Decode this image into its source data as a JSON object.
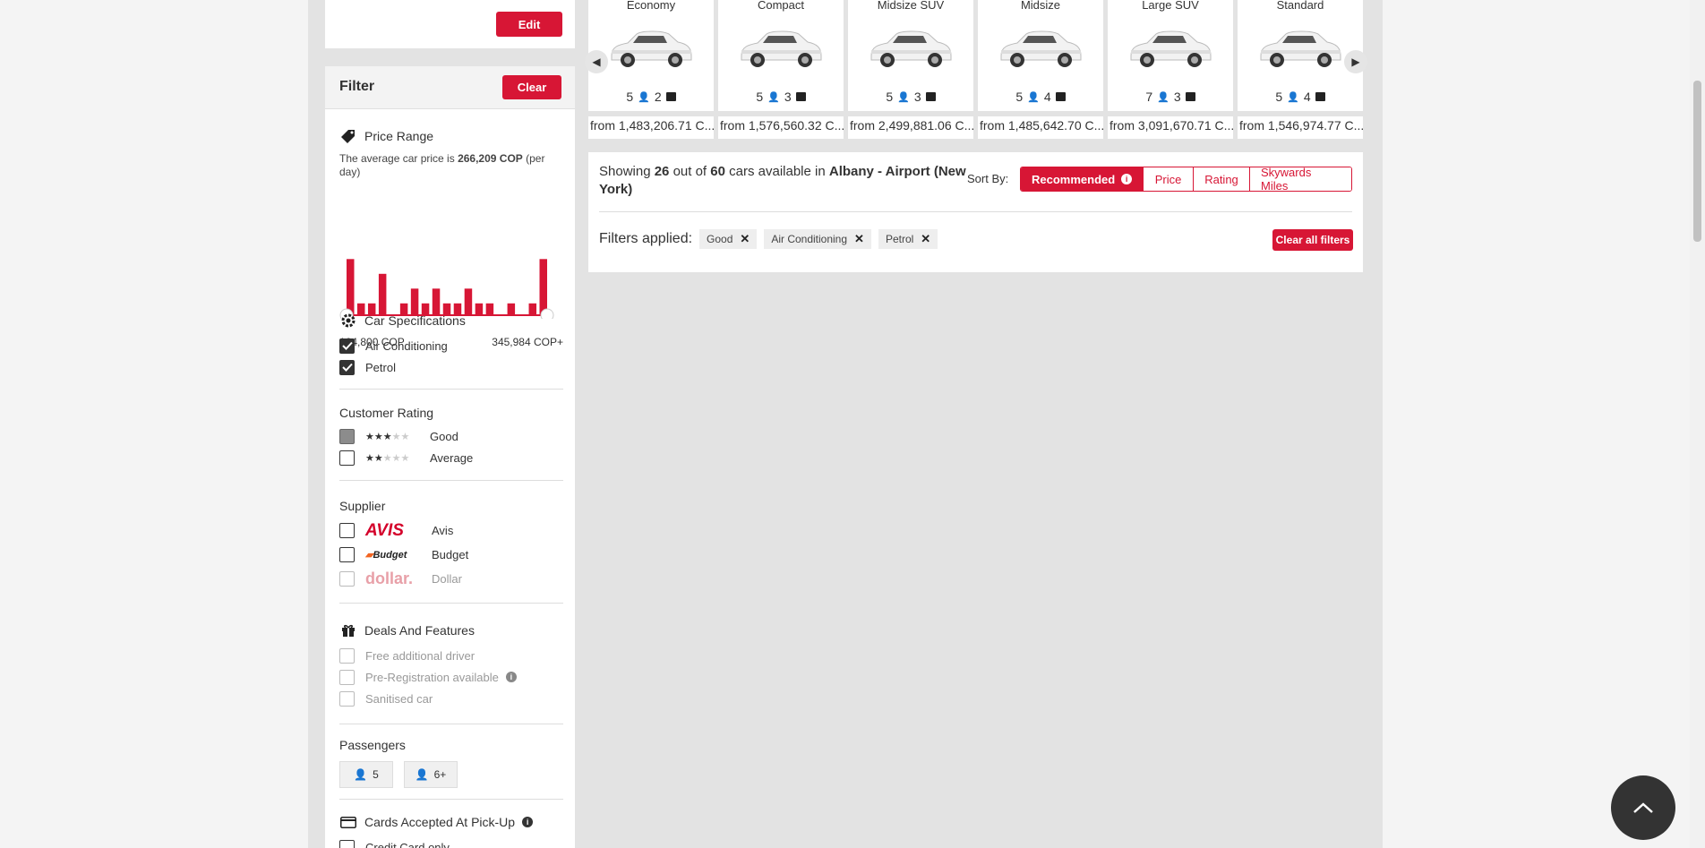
{
  "top_card": {
    "edit_label": "Edit"
  },
  "filter": {
    "title": "Filter",
    "clear_label": "Clear",
    "price_range": {
      "title": "Price Range",
      "avg_prefix": "The average car price is ",
      "avg_value": "266,209 COP",
      "avg_suffix": " (per day)",
      "min": "164,800 COP",
      "max": "345,984 COP+",
      "histogram": [
        0.95,
        0.2,
        0.2,
        0.7,
        0,
        0.2,
        0.45,
        0.2,
        0.45,
        0.2,
        0.2,
        0.45,
        0.2,
        0.2,
        0,
        0.2,
        0,
        0.2,
        0.95
      ]
    },
    "car_specs": {
      "title": "Car Specifications",
      "items": [
        {
          "label": "Air Conditioning",
          "state": "checked"
        },
        {
          "label": "Petrol",
          "state": "checked"
        }
      ]
    },
    "rating": {
      "title": "Customer Rating",
      "items": [
        {
          "label": "Good",
          "stars": 3,
          "state": "partial"
        },
        {
          "label": "Average",
          "stars": 2,
          "state": "unchecked"
        }
      ]
    },
    "supplier": {
      "title": "Supplier",
      "items": [
        {
          "logo": "AVIS",
          "label": "Avis",
          "color": "#d4002a"
        },
        {
          "logo": "Budget",
          "label": "Budget",
          "color": "#f26522"
        },
        {
          "logo": "dollar.",
          "label": "Dollar",
          "color": "#e8a0a8"
        }
      ]
    },
    "deals": {
      "title": "Deals And Features",
      "items": [
        {
          "label": "Free additional driver"
        },
        {
          "label": "Pre-Registration available"
        },
        {
          "label": "Sanitised car"
        }
      ]
    },
    "passengers": {
      "title": "Passengers",
      "options": [
        "5",
        "6+"
      ]
    },
    "cards": {
      "title": "Cards Accepted At Pick-Up",
      "first_item": "Credit Card only"
    }
  },
  "cars": [
    {
      "name": "Economy",
      "seats": "5",
      "bags": "2",
      "price": "from 1,483,206.71 C..."
    },
    {
      "name": "Compact",
      "seats": "5",
      "bags": "3",
      "price": "from 1,576,560.32 C..."
    },
    {
      "name": "Midsize SUV",
      "seats": "5",
      "bags": "3",
      "price": "from 2,499,881.06 C..."
    },
    {
      "name": "Midsize",
      "seats": "5",
      "bags": "4",
      "price": "from 1,485,642.70 C..."
    },
    {
      "name": "Large SUV",
      "seats": "7",
      "bags": "3",
      "price": "from 3,091,670.71 C..."
    },
    {
      "name": "Standard",
      "seats": "5",
      "bags": "4",
      "price": "from 1,546,974.77 C..."
    }
  ],
  "results": {
    "showing": "Showing ",
    "count": "26",
    "out_of": " out of ",
    "total": "60",
    "available_in": " cars available in ",
    "location": "Albany - Airport (New York)",
    "sort_by": "Sort By:",
    "sort_options": [
      "Recommended",
      "Price",
      "Rating",
      "Skywards Miles"
    ],
    "filters_applied": "Filters applied:",
    "chips": [
      "Good",
      "Air Conditioning",
      "Petrol"
    ],
    "clear_all": "Clear all filters"
  },
  "colors": {
    "accent": "#d71635",
    "dark": "#333333"
  }
}
